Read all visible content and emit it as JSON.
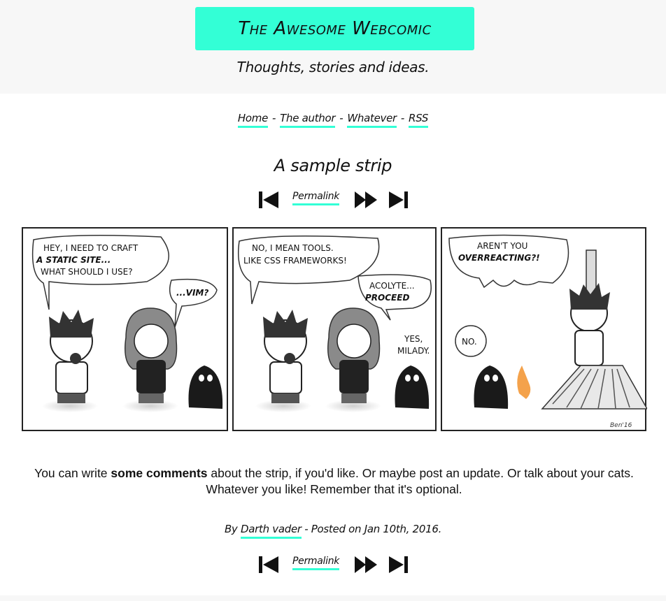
{
  "header": {
    "site_title": "The Awesome Webcomic",
    "tagline": "Thoughts, stories and ideas."
  },
  "nav": {
    "items": [
      {
        "label": "Home"
      },
      {
        "label": "The author"
      },
      {
        "label": "Whatever"
      },
      {
        "label": "RSS"
      }
    ],
    "separator": "-"
  },
  "strip": {
    "title": "A sample strip",
    "panel1": {
      "bubble1": [
        "HEY, I NEED TO CRAFT",
        "A STATIC SITE...",
        "WHAT SHOULD I USE?"
      ],
      "bubble2": "...VIM?"
    },
    "panel2": {
      "bubble1": [
        "NO, I MEAN TOOLS.",
        "LIKE CSS FRAMEWORKS!"
      ],
      "bubble2": [
        "ACOLYTE...",
        "PROCEED"
      ],
      "bubble3": [
        "YES,",
        "MILADY."
      ]
    },
    "panel3": {
      "bubble1": [
        "AREN'T YOU",
        "OVERREACTING?!"
      ],
      "bubble2": "NO.",
      "signature": "Ben'16"
    }
  },
  "pager": {
    "permalink_label": "Permalink",
    "first_icon": "first-page-icon",
    "next_icon": "next-page-icon",
    "last_icon": "last-page-icon"
  },
  "comment": {
    "before": "You can write ",
    "bold": "some comments",
    "after": " about the strip, if you'd like. Or maybe post an update. Or talk about your cats. Whatever you like! Remember that it's optional."
  },
  "byline": {
    "prefix": "By",
    "author": "Darth vader",
    "posted": "- Posted on Jan 10th, 2016."
  },
  "colors": {
    "accent": "#33ffd6",
    "header_bg": "#f7f7f7",
    "text": "#111111"
  }
}
